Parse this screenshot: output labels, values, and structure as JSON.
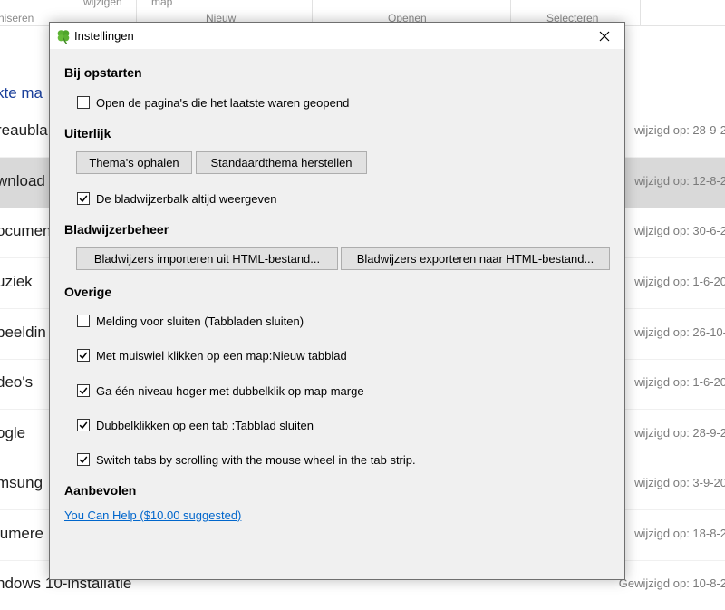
{
  "background": {
    "ribbon": {
      "top_labels": [
        "wijzigen",
        "map"
      ],
      "groups": [
        "niseren",
        "Nieuw",
        "Openen",
        "Selecteren"
      ]
    },
    "nav_link": "kte ma",
    "rows": [
      {
        "name": "reaubla",
        "date": "wijzigd op: 28-9-2"
      },
      {
        "name": "wnload",
        "date": "wijzigd op: 12-8-2"
      },
      {
        "name": "ocumen",
        "date": "wijzigd op: 30-6-2"
      },
      {
        "name": "uziek",
        "date": "wijzigd op: 1-6-20"
      },
      {
        "name": "beeldin",
        "date": "wijzigd op: 26-10-"
      },
      {
        "name": "deo's",
        "date": "wijzigd op: 1-6-20"
      },
      {
        "name": "ogle",
        "date": "wijzigd op: 28-9-2"
      },
      {
        "name": "msung",
        "date": "wijzigd op: 3-9-20"
      },
      {
        "name": "lumere",
        "date": "wijzigd op: 18-8-2"
      },
      {
        "name": "ndows 10-installatie",
        "date": "Gewijzigd op: 10-8-2"
      }
    ]
  },
  "dialog": {
    "title": "Instellingen",
    "icon": "clover-icon",
    "sections": {
      "startup": {
        "heading": "Bij opstarten",
        "open_last_pages": {
          "label": "Open de pagina's die het laatste waren geopend",
          "checked": false
        }
      },
      "appearance": {
        "heading": "Uiterlijk",
        "get_themes": "Thema's ophalen",
        "restore_theme": "Standaardthema herstellen",
        "always_show_bar": {
          "label": "De bladwijzerbalk altijd weergeven",
          "checked": true
        }
      },
      "bookmarks": {
        "heading": "Bladwijzerbeheer",
        "import": "Bladwijzers importeren uit HTML-bestand...",
        "export": "Bladwijzers exporteren naar HTML-bestand..."
      },
      "other": {
        "heading": "Overige",
        "options": [
          {
            "label": "Melding voor sluiten (Tabbladen sluiten)",
            "checked": false
          },
          {
            "label": "Met muiswiel klikken op een map:Nieuw tabblad",
            "checked": true
          },
          {
            "label": "Ga één niveau hoger met dubbelklik op map marge",
            "checked": true
          },
          {
            "label": "Dubbelklikken op een tab :Tabblad sluiten",
            "checked": true
          },
          {
            "label": "Switch tabs by scrolling with the mouse wheel in the tab strip.",
            "checked": true
          }
        ]
      },
      "recommended": {
        "heading": "Aanbevolen",
        "help_link": "You Can Help ($10.00 suggested)"
      }
    }
  },
  "colors": {
    "dialog_bg": "#f0f0f0",
    "link": "#0066cc",
    "selected_row": "#d9d9d9",
    "icon_green": "#5bb033"
  }
}
